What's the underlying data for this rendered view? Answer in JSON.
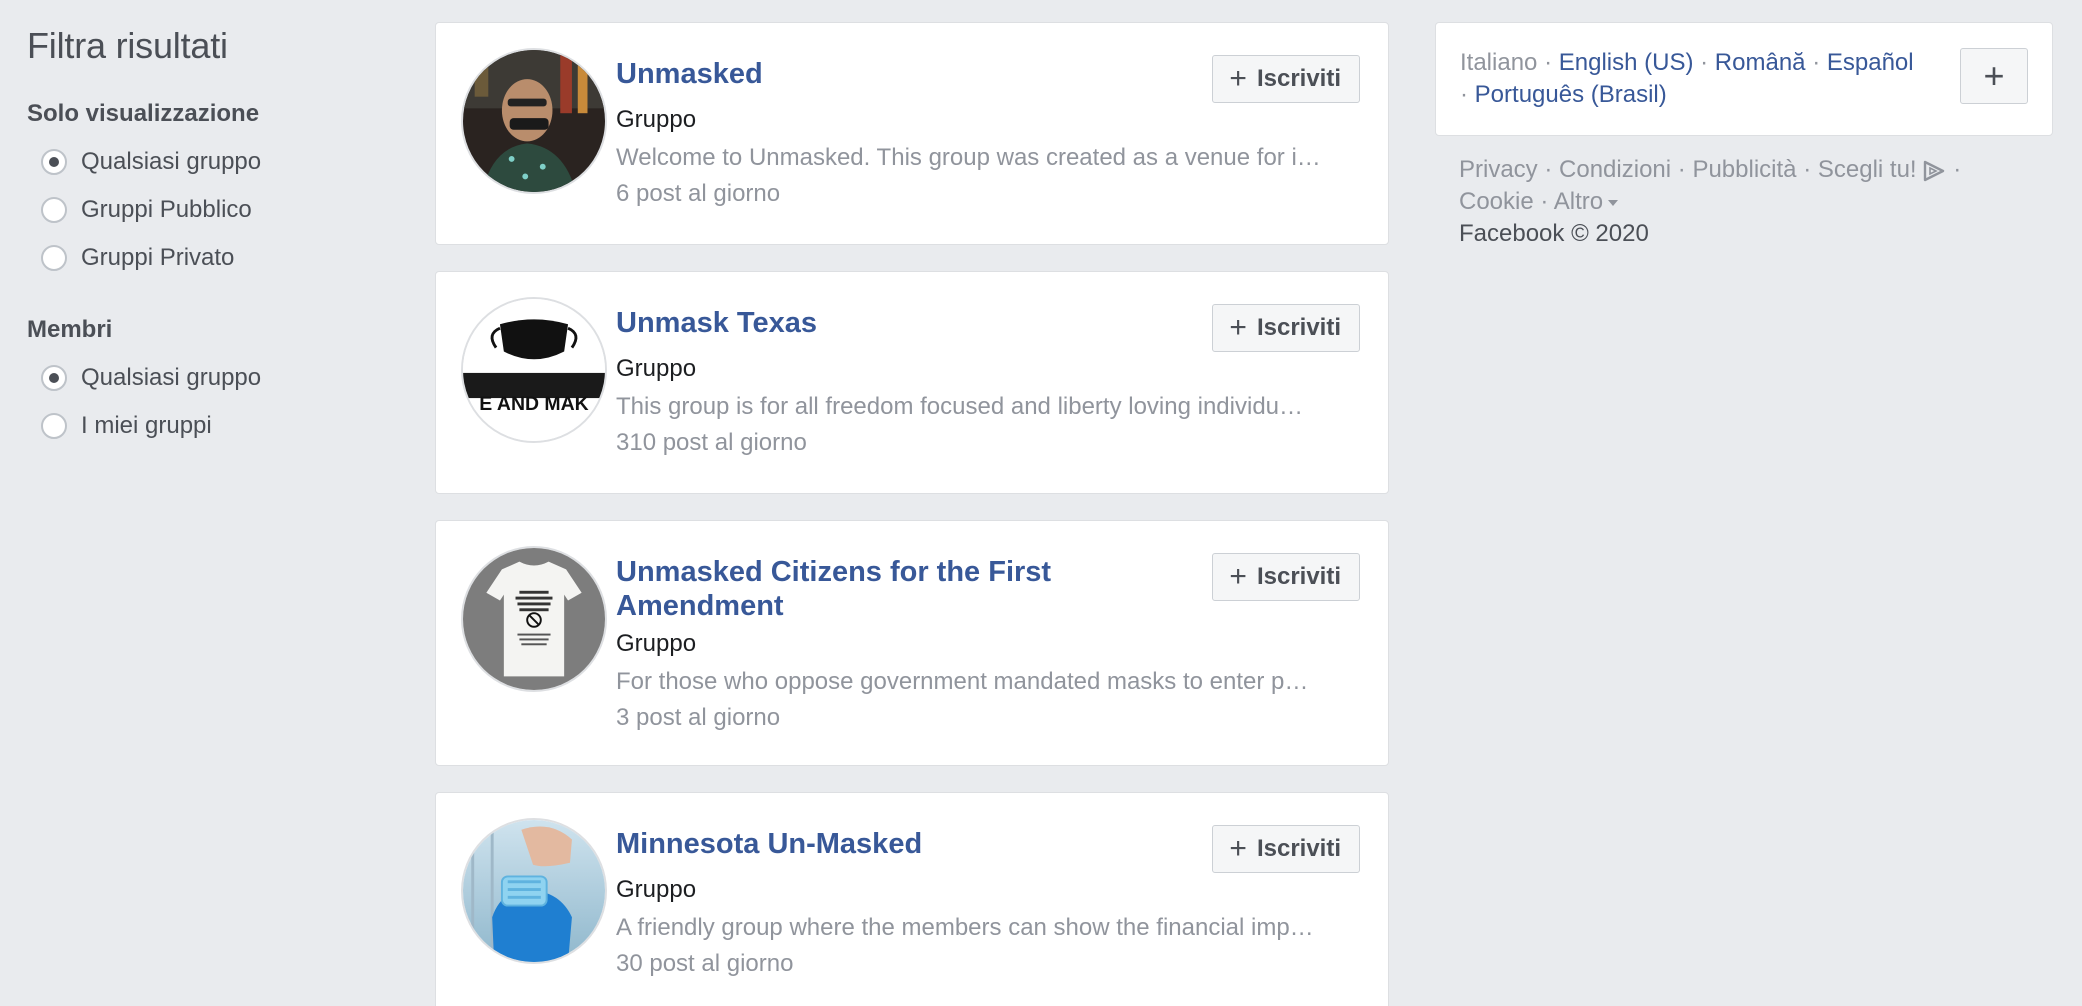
{
  "filters": {
    "title": "Filtra risultati",
    "groups": [
      {
        "heading": "Solo visualizzazione",
        "options": [
          {
            "label": "Qualsiasi gruppo",
            "checked": true
          },
          {
            "label": "Gruppi Pubblico",
            "checked": false
          },
          {
            "label": "Gruppi Privato",
            "checked": false
          }
        ]
      },
      {
        "heading": "Membri",
        "options": [
          {
            "label": "Qualsiasi gruppo",
            "checked": true
          },
          {
            "label": "I miei gruppi",
            "checked": false
          }
        ]
      }
    ]
  },
  "results": [
    {
      "title": "Unmasked",
      "type": "Gruppo",
      "description": "Welcome to Unmasked. This group was created as a venue for i…",
      "activity": "6 post al giorno",
      "join_label": "Iscriviti"
    },
    {
      "title": "Unmask Texas",
      "type": "Gruppo",
      "description": "This group is for all freedom focused and liberty loving individu…",
      "activity": "310 post al giorno",
      "join_label": "Iscriviti",
      "avatar_text": "E AND MAK"
    },
    {
      "title": "Unmasked Citizens for the First Amendment",
      "type": "Gruppo",
      "description": "For those who oppose government mandated masks to enter p…",
      "activity": "3 post al giorno",
      "join_label": "Iscriviti"
    },
    {
      "title": "Minnesota Un-Masked",
      "type": "Gruppo",
      "description": "A friendly group where the members can show the financial imp…",
      "activity": "30 post al giorno",
      "join_label": "Iscriviti"
    }
  ],
  "languages": {
    "current": "Italiano",
    "links": [
      "English (US)",
      "Română",
      "Español",
      "Português (Brasil)"
    ],
    "add_label": "+"
  },
  "footer": {
    "links": [
      "Privacy",
      "Condizioni",
      "Pubblicità",
      "Scegli tu!",
      "Cookie",
      "Altro"
    ],
    "copyright": "Facebook © 2020"
  },
  "colors": {
    "background": "#e9ebee",
    "link": "#385898",
    "muted": "#90949c"
  }
}
